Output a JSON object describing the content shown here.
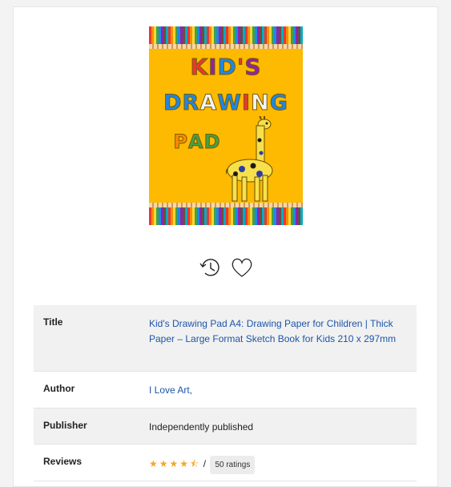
{
  "cover": {
    "line1": "KID'S",
    "line2": "DRAWING",
    "line3": "PAD"
  },
  "actions": {
    "history_icon": "history-clock-icon",
    "favorite_icon": "heart-icon"
  },
  "details": {
    "title_label": "Title",
    "title_value": "Kid's Drawing Pad A4: Drawing Paper for Children | Thick Paper – Large Format Sketch Book for Kids 210 x 297mm",
    "author_label": "Author",
    "author_value": "I Love Art,",
    "publisher_label": "Publisher",
    "publisher_value": "Independently published",
    "reviews_label": "Reviews",
    "rating": 4.5,
    "rating_stars": "★★★★⯪",
    "rating_separator": "/",
    "ratings_count": "50 ratings"
  },
  "colors": {
    "link": "#1d56a8",
    "star": "#f5a623",
    "cover_bg": "#fdba00"
  }
}
